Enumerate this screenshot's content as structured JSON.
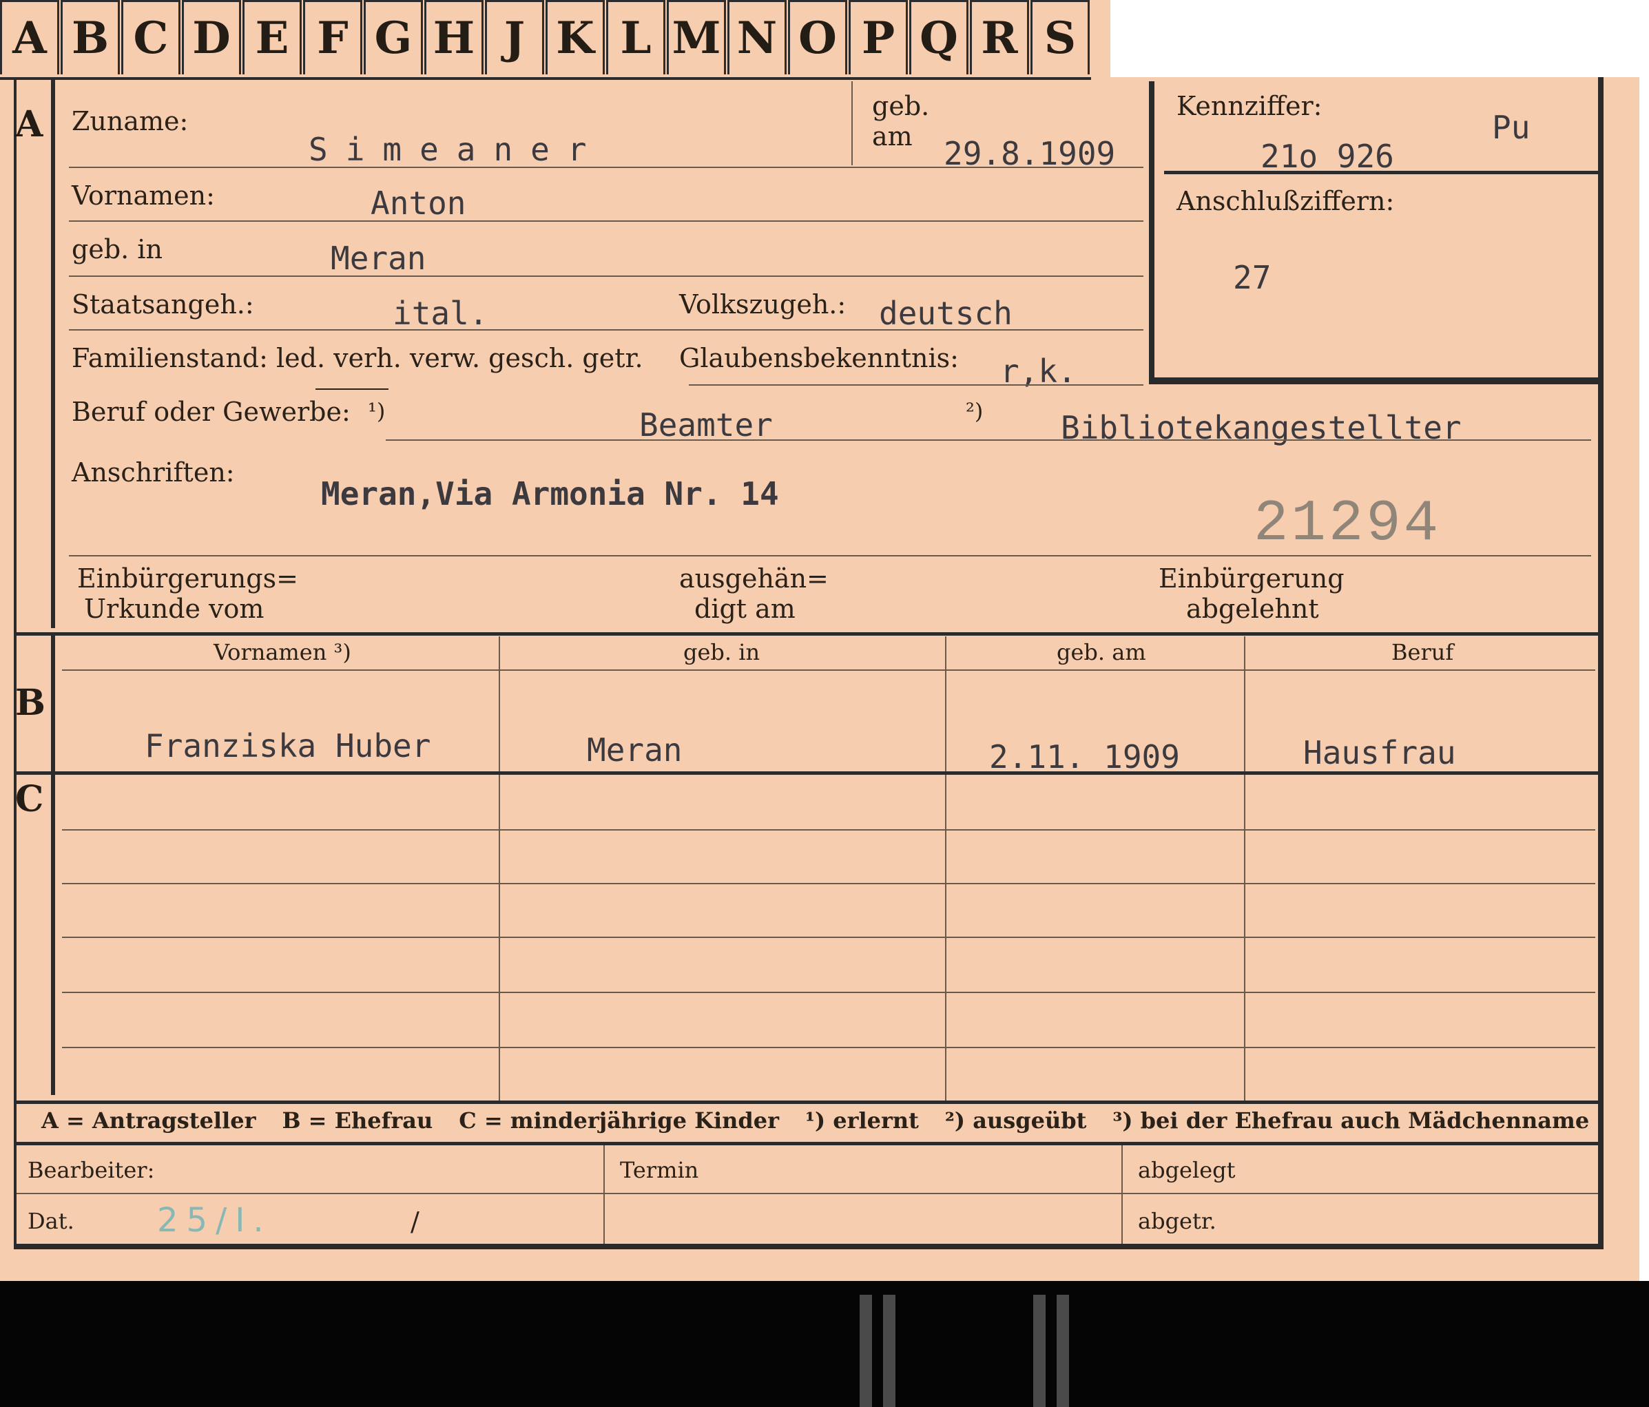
{
  "tabs": [
    "A",
    "B",
    "C",
    "D",
    "E",
    "F",
    "G",
    "H",
    "J",
    "K",
    "L",
    "M",
    "N",
    "O",
    "P",
    "Q",
    "R",
    "S"
  ],
  "section_a": {
    "letter": "A",
    "zuname_label": "Zuname:",
    "zuname_value": "Simeaner",
    "geb_am_label_1": "geb.",
    "geb_am_label_2": "am",
    "geb_am_value": "29.8.1909",
    "vornamen_label": "Vornamen:",
    "vornamen_value": "Anton",
    "geb_in_label": "geb. in",
    "geb_in_value": "Meran",
    "staatsangeh_label": "Staatsangeh.:",
    "staatsangeh_value": "ital.",
    "volkszugeh_label": "Volkszugeh.:",
    "volkszugeh_value": "deutsch",
    "familienstand_label": "Familienstand: led. verh. verw. gesch. getr.",
    "glaubens_label": "Glaubensbekenntnis:",
    "glaubens_value": "r,k.",
    "beruf_label": "Beruf oder Gewerbe:",
    "beruf_mark_1": "¹)",
    "beruf_value_1": "Beamter",
    "beruf_mark_2": "²)",
    "beruf_value_2": "Bibliotekangestellter",
    "anschriften_label": "Anschriften:",
    "anschriften_value": "Meran,Via Armonia Nr. 14",
    "stamp_number": "21294",
    "einb_urkunde_1": "Einbürgerungs=",
    "einb_urkunde_2": "Urkunde vom",
    "ausgehaendigt_1": "ausgehän=",
    "ausgehaendigt_2": "digt am",
    "einb_abgelehnt_1": "Einbürgerung",
    "einb_abgelehnt_2": "abgelehnt"
  },
  "kennziffer": {
    "label": "Kennziffer:",
    "value": "21o 926",
    "code": "Pu",
    "anschluss_label": "Anschlußziffern:",
    "anschluss_value": "27"
  },
  "section_b": {
    "letter": "B",
    "headers": [
      "Vornamen ³)",
      "geb. in",
      "geb. am",
      "Beruf"
    ],
    "row": [
      "Franziska Huber",
      "Meran",
      "2.11. 1909",
      "Hausfrau"
    ]
  },
  "section_c": {
    "letter": "C"
  },
  "legend": {
    "a": "A = Antragsteller",
    "b": "B = Ehefrau",
    "c": "C = minderjährige Kinder",
    "n1": "¹) erlernt",
    "n2": "²) ausgeübt",
    "n3": "³) bei der Ehefrau auch Mädchenname"
  },
  "footer": {
    "bearbeiter_label": "Bearbeiter:",
    "dat_label": "Dat.",
    "dat_value": "25/I.",
    "dat_slash": "/",
    "termin_label": "Termin",
    "abgelegt_label": "abgelegt",
    "abgetr_label": "abgetr."
  },
  "colors": {
    "card": "#f7cdb0",
    "ink": "#2a2118",
    "typewriter": "#3c3a3f",
    "stamp": "#8f8578",
    "pencil": "#88b8b3"
  }
}
